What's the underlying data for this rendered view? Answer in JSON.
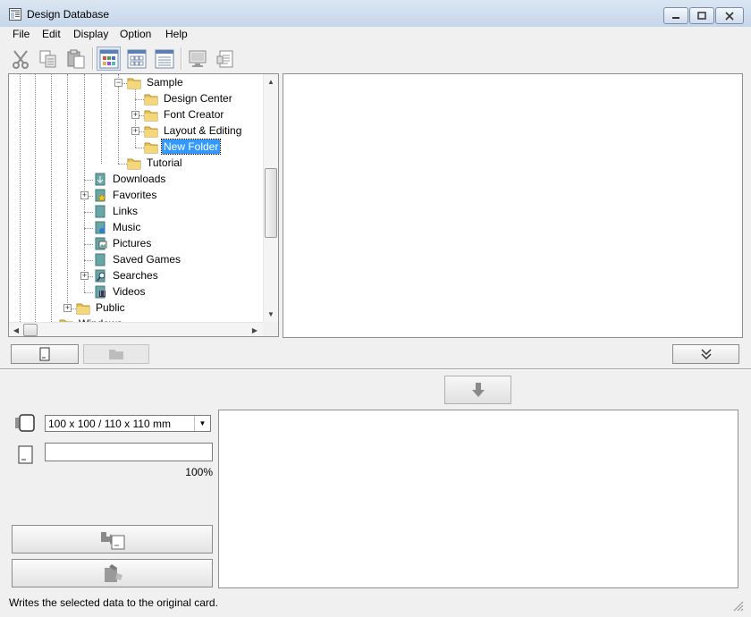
{
  "window": {
    "title": "Design Database"
  },
  "menu": [
    "File",
    "Edit",
    "Display",
    "Option",
    "Help"
  ],
  "toolbar": [
    {
      "name": "cut",
      "icon": "scissors-icon"
    },
    {
      "name": "copy",
      "icon": "copy-icon"
    },
    {
      "name": "paste",
      "icon": "paste-icon"
    },
    {
      "name": "view-large-icons",
      "icon": "large-icons-view-icon",
      "active": true
    },
    {
      "name": "view-small-icons",
      "icon": "small-icons-view-icon"
    },
    {
      "name": "view-list",
      "icon": "list-view-icon"
    },
    {
      "name": "preview",
      "icon": "monitor-icon"
    },
    {
      "name": "properties",
      "icon": "document-properties-icon"
    }
  ],
  "tree": {
    "nodes": [
      {
        "label": "Sample",
        "icon": "folder-icon",
        "expander": "minus"
      },
      {
        "label": "Design Center",
        "icon": "folder-icon"
      },
      {
        "label": "Font Creator",
        "icon": "folder-icon",
        "expander": "plus"
      },
      {
        "label": "Layout & Editing",
        "icon": "folder-icon",
        "expander": "plus"
      },
      {
        "label": "New Folder",
        "icon": "folder-icon",
        "selected": true
      },
      {
        "label": "Tutorial",
        "icon": "folder-icon"
      },
      {
        "label": "Downloads",
        "icon": "downloads-folder-icon"
      },
      {
        "label": "Favorites",
        "icon": "favorites-folder-icon",
        "expander": "plus"
      },
      {
        "label": "Links",
        "icon": "links-folder-icon"
      },
      {
        "label": "Music",
        "icon": "music-folder-icon"
      },
      {
        "label": "Pictures",
        "icon": "pictures-folder-icon"
      },
      {
        "label": "Saved Games",
        "icon": "saved-games-folder-icon"
      },
      {
        "label": "Searches",
        "icon": "searches-folder-icon",
        "expander": "plus"
      },
      {
        "label": "Videos",
        "icon": "videos-folder-icon"
      },
      {
        "label": "Public",
        "icon": "folder-icon",
        "expander": "plus"
      },
      {
        "label": "Windows",
        "icon": "folder-icon"
      }
    ]
  },
  "card": {
    "size_options": "100 x 100 / 110 x 110 mm",
    "progress_percent": 100,
    "progress_label": "100%"
  },
  "status": {
    "text": "Writes the selected data to the original card."
  },
  "colors": {
    "selection": "#3399ff",
    "titlebar": "#c5d6ea"
  }
}
